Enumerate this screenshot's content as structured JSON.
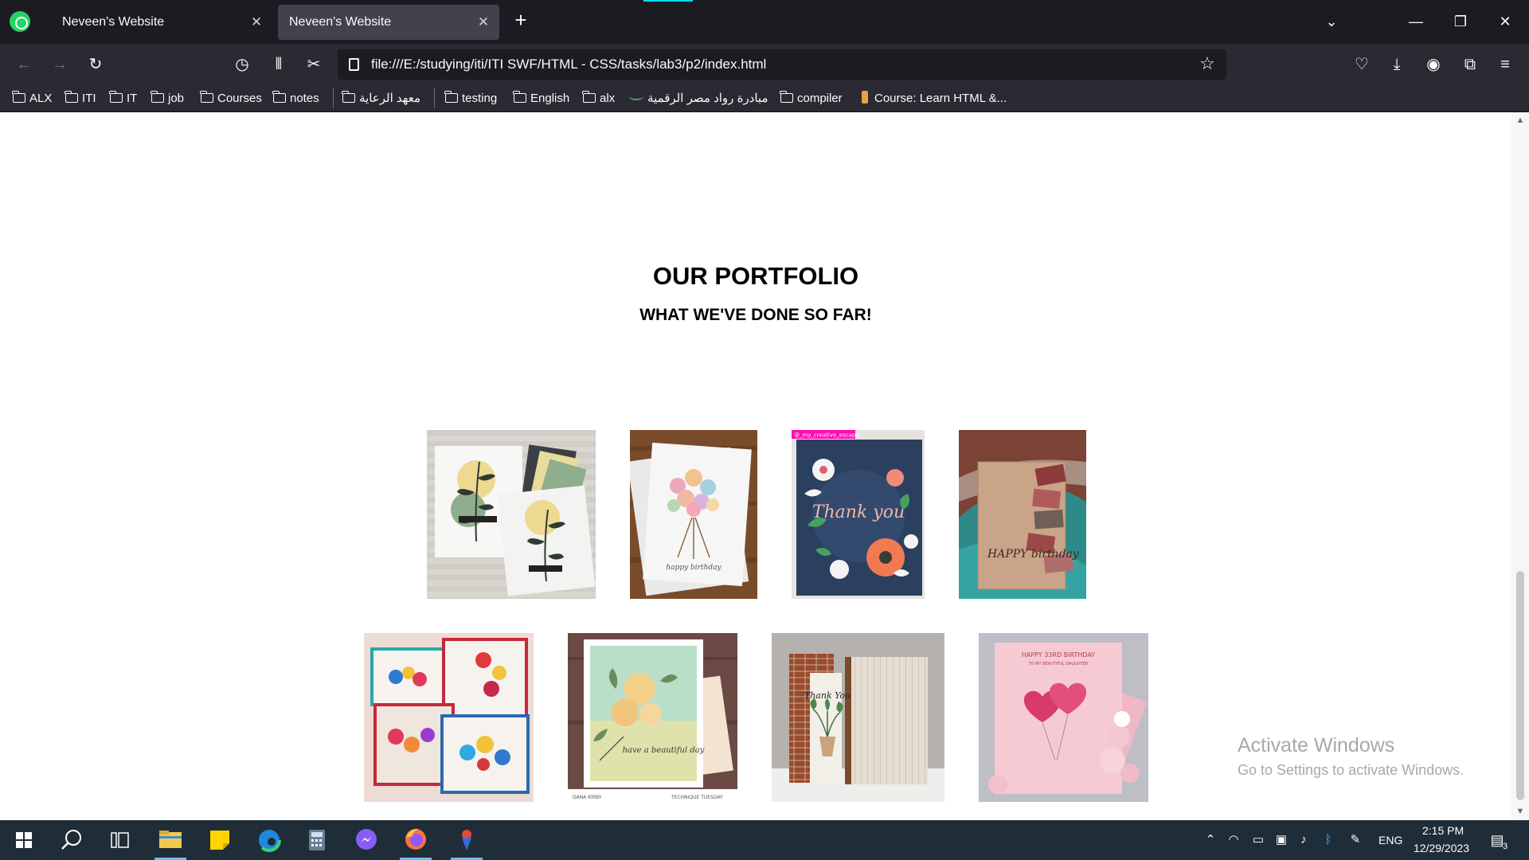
{
  "browser": {
    "tabs": [
      {
        "title": "Neveen's Website",
        "active": false
      },
      {
        "title": "Neveen's Website",
        "active": true
      }
    ],
    "url": "file:///E:/studying/iti/ITI SWF/HTML - CSS/tasks/lab3/p2/index.html",
    "bookmarks": [
      "ALX",
      "ITI",
      "IT",
      "job",
      "Courses",
      "notes",
      "معهد الرعاية",
      "testing",
      "English",
      "alx",
      "مبادرة رواد مصر الرقمية",
      "compiler",
      "Course: Learn HTML &..."
    ],
    "glyphs": {
      "close": "✕",
      "new_tab": "+",
      "chevron": "⌄",
      "minimize": "—",
      "restore": "❐",
      "back": "←",
      "forward": "→",
      "reload": "↻",
      "history": "◷",
      "library": "⫴",
      "screenshot": "✂",
      "star": "☆",
      "pocket": "♡",
      "download": "⤓",
      "account": "◉",
      "extensions": "⧉",
      "menu": "≡"
    }
  },
  "page": {
    "title": "OUR PORTFOLIO",
    "subtitle": "WHAT WE'VE DONE SO FAR!",
    "cards": [
      {
        "name": "leaf-cards"
      },
      {
        "name": "bouquet-birthday-card",
        "caption": "happy birthday"
      },
      {
        "name": "thank-you-floral-card",
        "caption": "Thank you",
        "tag": "@_my_creative_escape_"
      },
      {
        "name": "envelopes-birthday-card",
        "caption": "HAPPY birthday"
      },
      {
        "name": "rose-cards"
      },
      {
        "name": "beautiful-day-card",
        "caption": "have a beautiful day",
        "credit_left": "DANA KIRBY",
        "credit_right": "TECHNIQUE TUESDAY"
      },
      {
        "name": "thank-you-plant-card",
        "caption": "Thank You"
      },
      {
        "name": "heart-balloons-card",
        "caption": "HAPPY 33RD BIRTHDAY",
        "caption_sub": "TO MY BEAUTIFUL DAUGHTER"
      }
    ],
    "watermark": {
      "title": "Activate Windows",
      "subtitle": "Go to Settings to activate Windows."
    }
  },
  "taskbar": {
    "lang": "ENG",
    "time": "2:15 PM",
    "date": "12/29/2023",
    "notifications": "3",
    "apps": [
      "start",
      "search",
      "task-view",
      "file-explorer",
      "sticky-notes",
      "edge",
      "calculator",
      "messenger",
      "firefox",
      "app"
    ]
  }
}
